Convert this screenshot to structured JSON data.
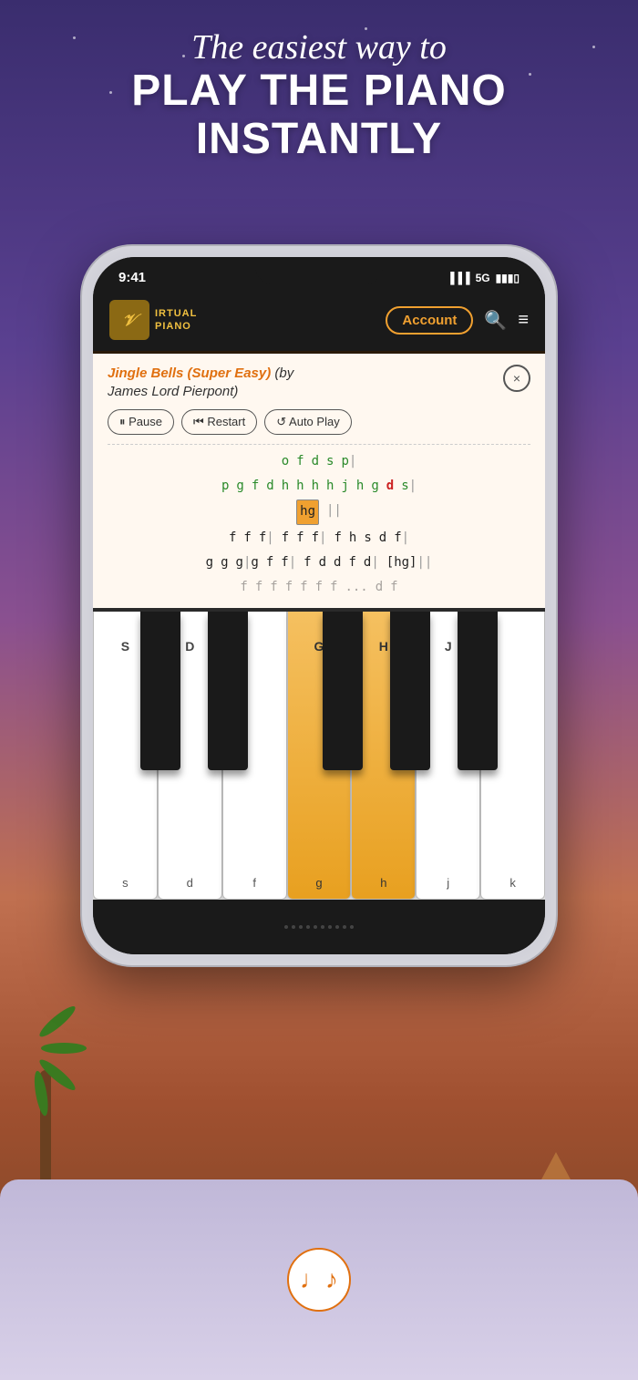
{
  "background": {
    "gradient_start": "#3a2d6e",
    "gradient_end": "#704020"
  },
  "header": {
    "line1": "The easiest way to",
    "line2_part1": "PLAY THE PIANO",
    "line2_part2": "INSTANTLY"
  },
  "phone": {
    "status_bar": {
      "time": "9:41",
      "signal": "5G",
      "battery": "▮▮▮"
    },
    "app_header": {
      "logo_letter": "V",
      "logo_text_line1": "IRTUAL",
      "logo_text_line2": "PIANO",
      "account_btn": "Account",
      "search_icon": "search",
      "menu_icon": "menu"
    },
    "sheet": {
      "song_title_highlight": "Jingle Bells (Super Easy)",
      "song_title_rest": "(by James Lord Pierpont)",
      "close_btn": "×",
      "controls": {
        "pause": "⏸ Pause",
        "restart": "⏮ Restart",
        "autoplay": "↺ Auto Play"
      },
      "note_rows": [
        {
          "notes": [
            "o",
            "f",
            "d",
            "s",
            "p|"
          ],
          "colors": [
            "green",
            "green",
            "green",
            "green",
            "green"
          ]
        },
        {
          "notes": [
            "p",
            "g",
            "f",
            "d",
            "h",
            "h",
            "h",
            "h",
            "j",
            "h",
            "g",
            "d",
            "s|"
          ],
          "colors": [
            "green",
            "green",
            "green",
            "green",
            "green",
            "green",
            "green",
            "green",
            "green",
            "green",
            "green",
            "red",
            "green"
          ]
        },
        {
          "notes": [
            "[hg]|"
          ],
          "colors": [
            "highlight"
          ]
        },
        {
          "notes": [
            "f",
            "f",
            "f|",
            "f",
            "f",
            "f|",
            "f",
            "h",
            "s",
            "d",
            "f|"
          ],
          "colors": [
            "black",
            "black",
            "black",
            "black",
            "black",
            "black",
            "black",
            "black",
            "black",
            "black",
            "black"
          ]
        },
        {
          "notes": [
            "g",
            "g",
            "g|g",
            "f",
            "f|",
            "f",
            "d",
            "d",
            "f",
            "d|",
            "[hg]||"
          ],
          "colors": [
            "black",
            "black",
            "black",
            "black",
            "black",
            "black",
            "black",
            "black",
            "black",
            "black",
            "black",
            "black"
          ]
        },
        {
          "notes": [
            "f",
            "f",
            "f",
            "f",
            "f",
            "f",
            "f",
            "f",
            "...",
            "d",
            "f"
          ],
          "colors": [
            "black",
            "black",
            "black",
            "black",
            "black",
            "black",
            "black",
            "black",
            "black",
            "black",
            "black"
          ]
        }
      ]
    },
    "piano": {
      "white_keys": [
        {
          "label": "s",
          "upper": "S",
          "active": false
        },
        {
          "label": "d",
          "upper": "D",
          "active": false
        },
        {
          "label": "f",
          "upper": "",
          "active": false
        },
        {
          "label": "g",
          "upper": "G",
          "active": true
        },
        {
          "label": "h",
          "upper": "H",
          "active": true
        },
        {
          "label": "j",
          "upper": "J",
          "active": false
        },
        {
          "label": "k",
          "upper": "",
          "active": false
        }
      ],
      "black_keys": [
        {
          "label": "",
          "position": 1
        },
        {
          "label": "",
          "position": 2
        },
        {
          "label": "",
          "position": 4
        },
        {
          "label": "",
          "position": 5
        },
        {
          "label": "",
          "position": 6
        }
      ]
    }
  },
  "bottom_section": {
    "music_button_icon": "♩♪"
  }
}
